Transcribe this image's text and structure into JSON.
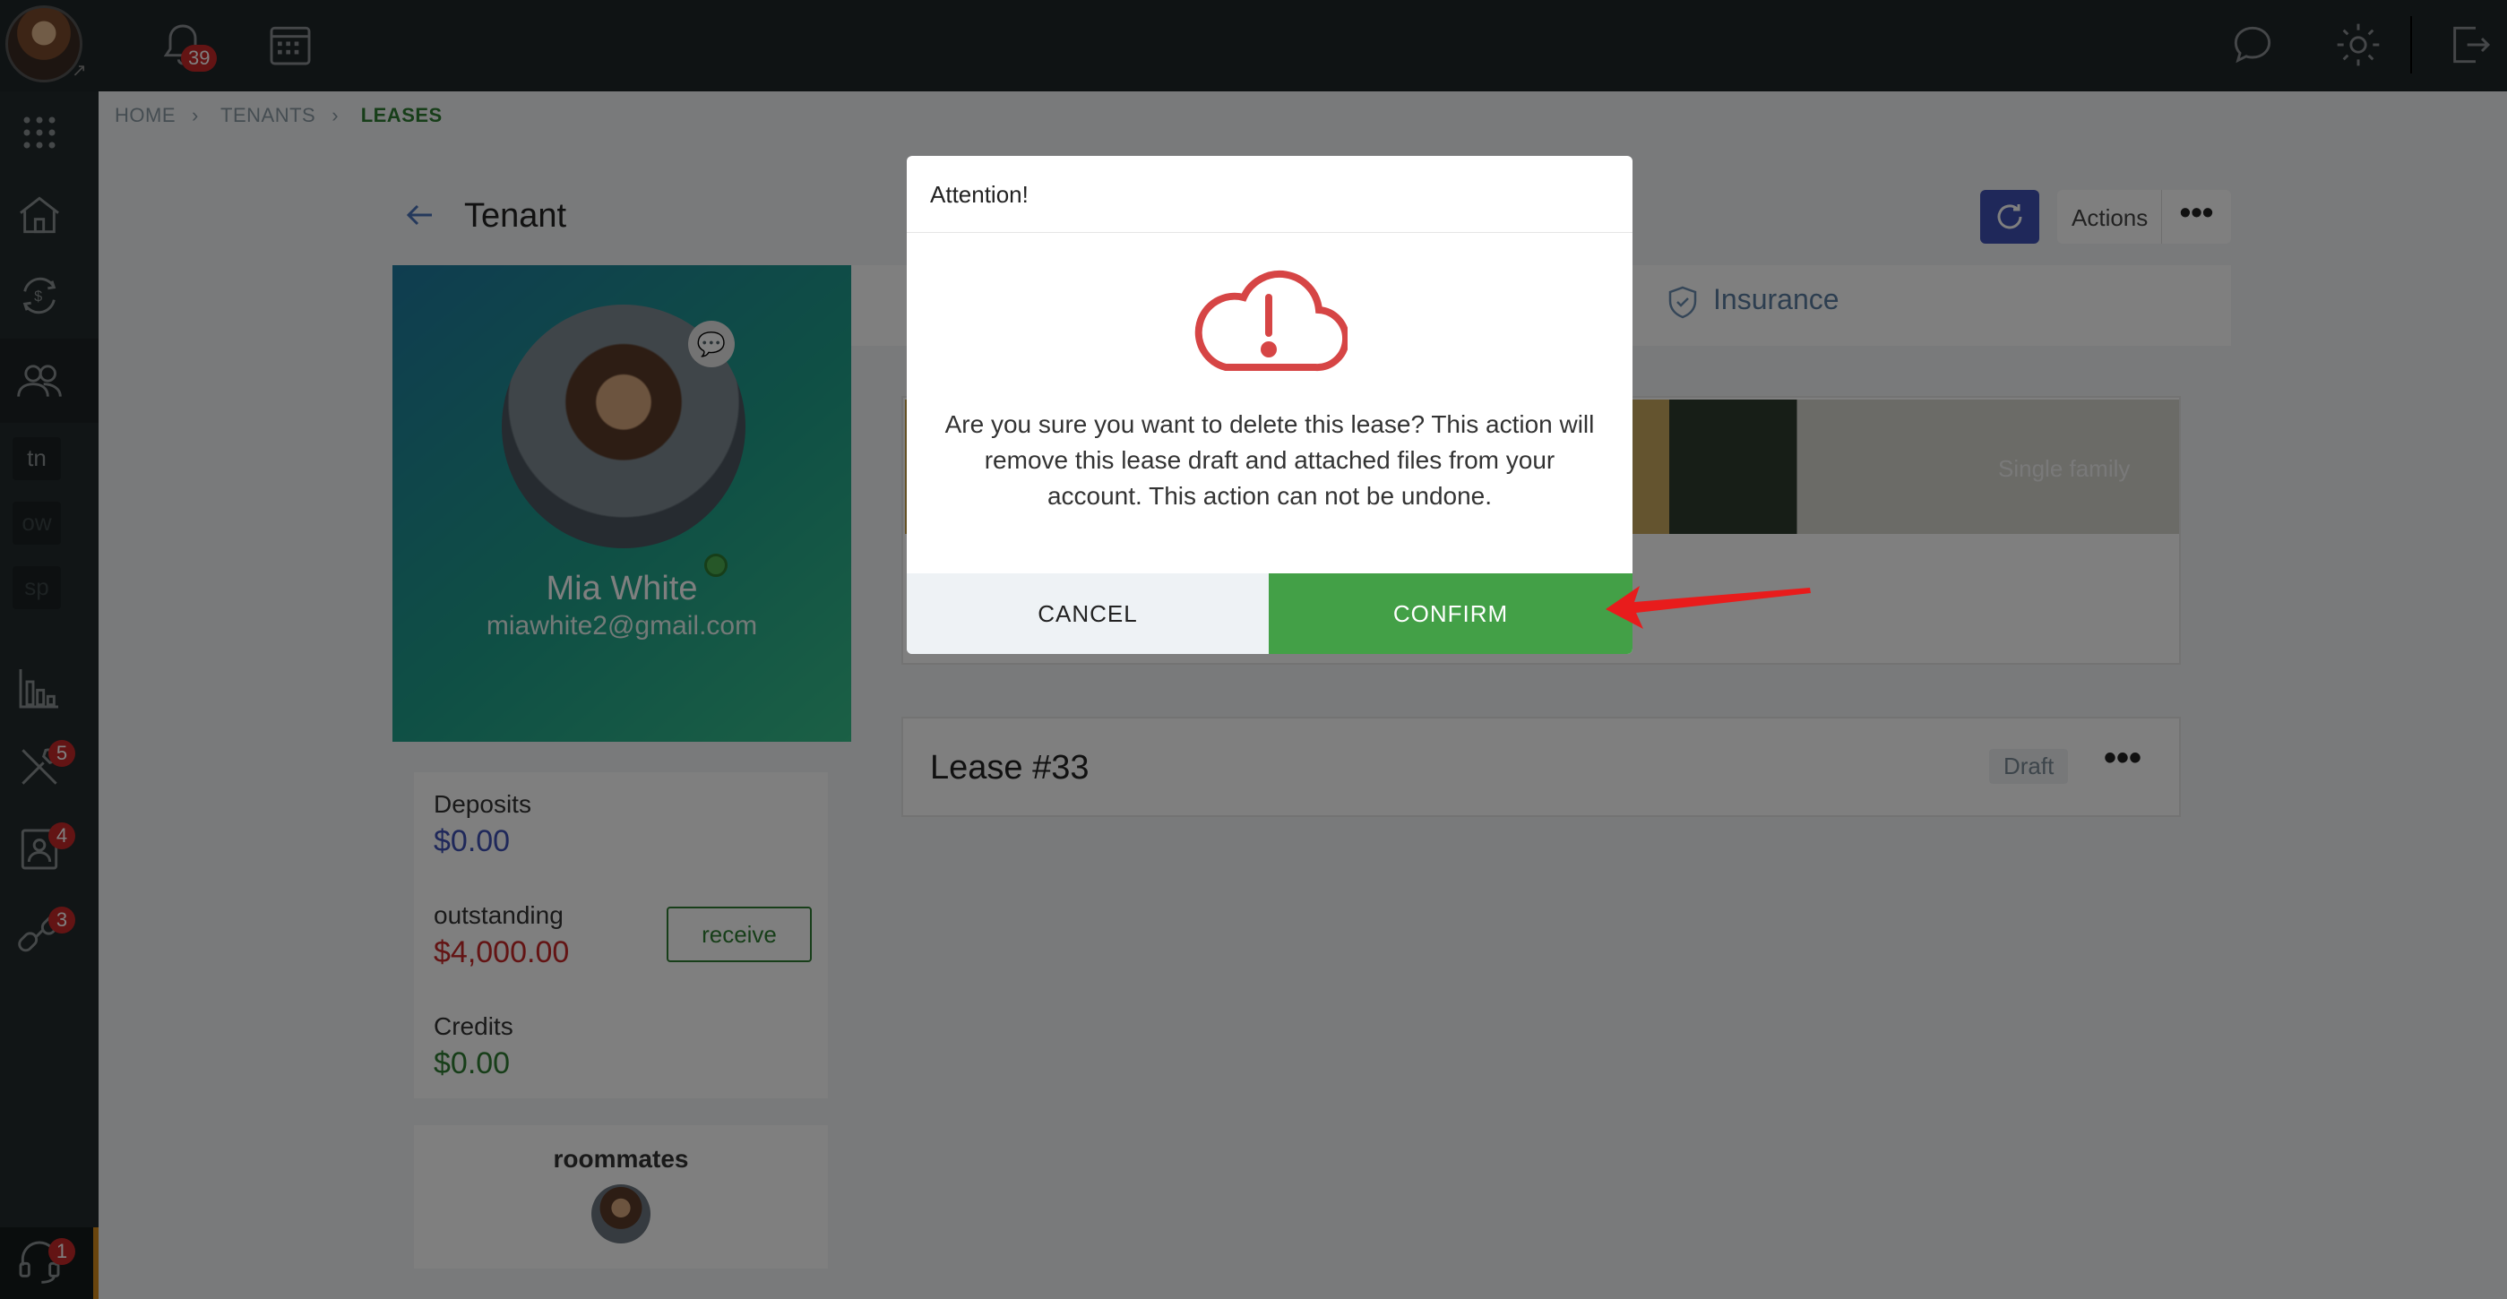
{
  "topbar": {
    "notifications_count": "39",
    "icons": [
      "bell-icon",
      "calendar-icon",
      "chat-icon",
      "gear-icon",
      "logout-icon"
    ]
  },
  "sidebar": {
    "items": [
      "apps-grid-icon",
      "properties-icon",
      "transactions-icon",
      "tenants-icon",
      "reports-icon",
      "maintenance-icon",
      "contacts-icon",
      "links-icon",
      "support-icon"
    ],
    "abbreviations": [
      "tn",
      "ow",
      "sp"
    ],
    "maintenance_badge": "5",
    "contacts_badge": "4",
    "links_badge": "3",
    "support_badge": "1"
  },
  "breadcrumb": [
    "HOME",
    "TENANTS",
    "LEASES"
  ],
  "page": {
    "title": "Tenant",
    "actions_label": "Actions"
  },
  "profile": {
    "name": "Mia White",
    "email": "miawhite2@gmail.com"
  },
  "balances": {
    "deposits_label": "Deposits",
    "deposits_value": "$0.00",
    "outstanding_label": "outstanding",
    "outstanding_value": "$4,000.00",
    "receive_label": "receive",
    "credits_label": "Credits",
    "credits_value": "$0.00"
  },
  "roommates": {
    "title": "roommates"
  },
  "tabs": {
    "insurance": "Insurance"
  },
  "property": {
    "type": "Single family"
  },
  "lease": {
    "title": "Lease #33",
    "status": "Draft"
  },
  "modal": {
    "title": "Attention!",
    "message": "Are you sure you want to delete this lease? This action will remove this lease draft and attached files from your account. This action can not be undone.",
    "cancel_label": "CANCEL",
    "confirm_label": "CONFIRM"
  },
  "colors": {
    "topbar": "#1f2628",
    "sidebar": "#232b2c",
    "accent_green": "#43a047",
    "danger_red": "#d64545",
    "primary_blue": "#3f51b5",
    "deposits_blue": "#3f51b5",
    "outstanding_red": "#c62828",
    "credits_green": "#2e7d32"
  }
}
